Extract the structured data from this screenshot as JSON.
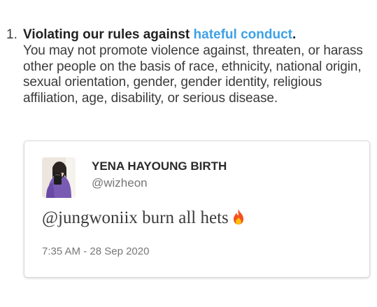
{
  "rule": {
    "number": "1.",
    "heading_prefix": "Violating our rules against ",
    "link_text": "hateful conduct",
    "heading_suffix": ".",
    "description": "You may not promote violence against, threaten, or harass other people on the basis of race, ethnicity, national origin, sexual orientation, gender, gender identity, religious affiliation, age, disability, or serious disease."
  },
  "tweet": {
    "author_name": "YENA HAYOUNG BIRTH",
    "author_handle": "@wizheon",
    "mention": "@jungwoniix",
    "body": " burn all hets",
    "emoji": "fire-icon",
    "timestamp": "7:35 AM - 28 Sep 2020"
  },
  "colors": {
    "link": "#3ea1e6",
    "text": "#3b3b3b",
    "muted": "#777777",
    "card_border": "#dcdcdc",
    "fire_outer": "#f4511e",
    "fire_inner": "#ffc107"
  }
}
